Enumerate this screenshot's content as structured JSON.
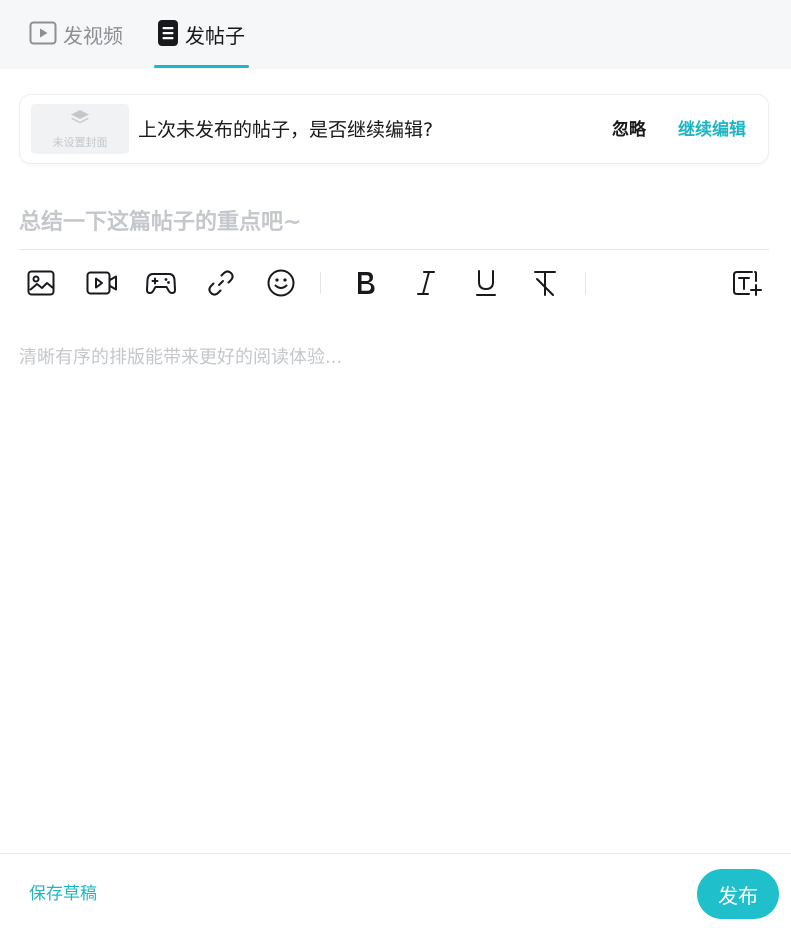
{
  "tabs": {
    "video_label": "发视频",
    "post_label": "发帖子"
  },
  "draft_notice": {
    "cover_text": "未设置封面",
    "message": "上次未发布的帖子，是否继续编辑?",
    "ignore_label": "忽略",
    "continue_label": "继续编辑"
  },
  "editor": {
    "title_placeholder": "总结一下这篇帖子的重点吧~",
    "body_placeholder": "清晰有序的排版能带来更好的阅读体验..."
  },
  "toolbar": {
    "icons": [
      "image-icon",
      "video-icon",
      "game-icon",
      "link-icon",
      "emoji-icon",
      "bold-icon",
      "italic-icon",
      "underline-icon",
      "clear-format-icon",
      "heading-icon"
    ]
  },
  "footer": {
    "save_draft_label": "保存草稿",
    "publish_label": "发布"
  },
  "colors": {
    "accent": "#1fb6c3",
    "publish_bg": "#1fc0cc",
    "placeholder": "#c4c7cc"
  }
}
